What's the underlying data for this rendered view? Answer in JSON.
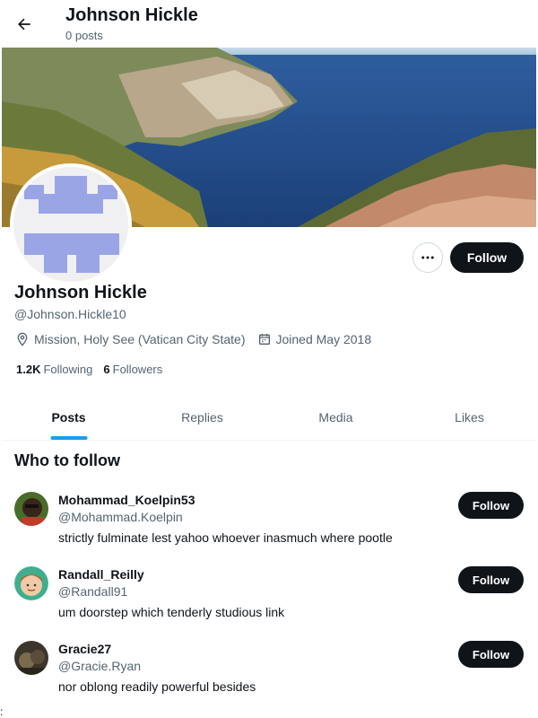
{
  "header": {
    "title": "Johnson Hickle",
    "subtitle": "0 posts"
  },
  "profile": {
    "name": "Johnson Hickle",
    "handle": "@Johnson.Hickle10",
    "location": "Mission, Holy See (Vatican City State)",
    "joined": "Joined May 2018",
    "following_count": "1.2K",
    "following_label": "Following",
    "followers_count": "6",
    "followers_label": "Followers",
    "follow_label": "Follow"
  },
  "tabs": [
    {
      "label": "Posts",
      "active": true
    },
    {
      "label": "Replies",
      "active": false
    },
    {
      "label": "Media",
      "active": false
    },
    {
      "label": "Likes",
      "active": false
    }
  ],
  "who_to_follow": {
    "title": "Who to follow",
    "suggestions": [
      {
        "name": "Mohammad_Koelpin53",
        "handle": "@Mohammad.Koelpin",
        "bio": "strictly fulminate lest yahoo whoever inasmuch where pootle",
        "follow_label": "Follow"
      },
      {
        "name": "Randall_Reilly",
        "handle": "@Randall91",
        "bio": "um doorstep which tenderly studious link",
        "follow_label": "Follow"
      },
      {
        "name": "Gracie27",
        "handle": "@Gracie.Ryan",
        "bio": "nor oblong readily powerful besides",
        "follow_label": "Follow"
      }
    ]
  },
  "stray_mark": ":",
  "colors": {
    "text_primary": "#0f1419",
    "text_secondary": "#536471",
    "accent": "#1d9bf0",
    "avatar_pattern": "#9aa5e6"
  },
  "icons": {
    "back": "arrow-left-icon",
    "more": "more-horizontal-icon",
    "location": "location-pin-icon",
    "calendar": "calendar-icon"
  }
}
